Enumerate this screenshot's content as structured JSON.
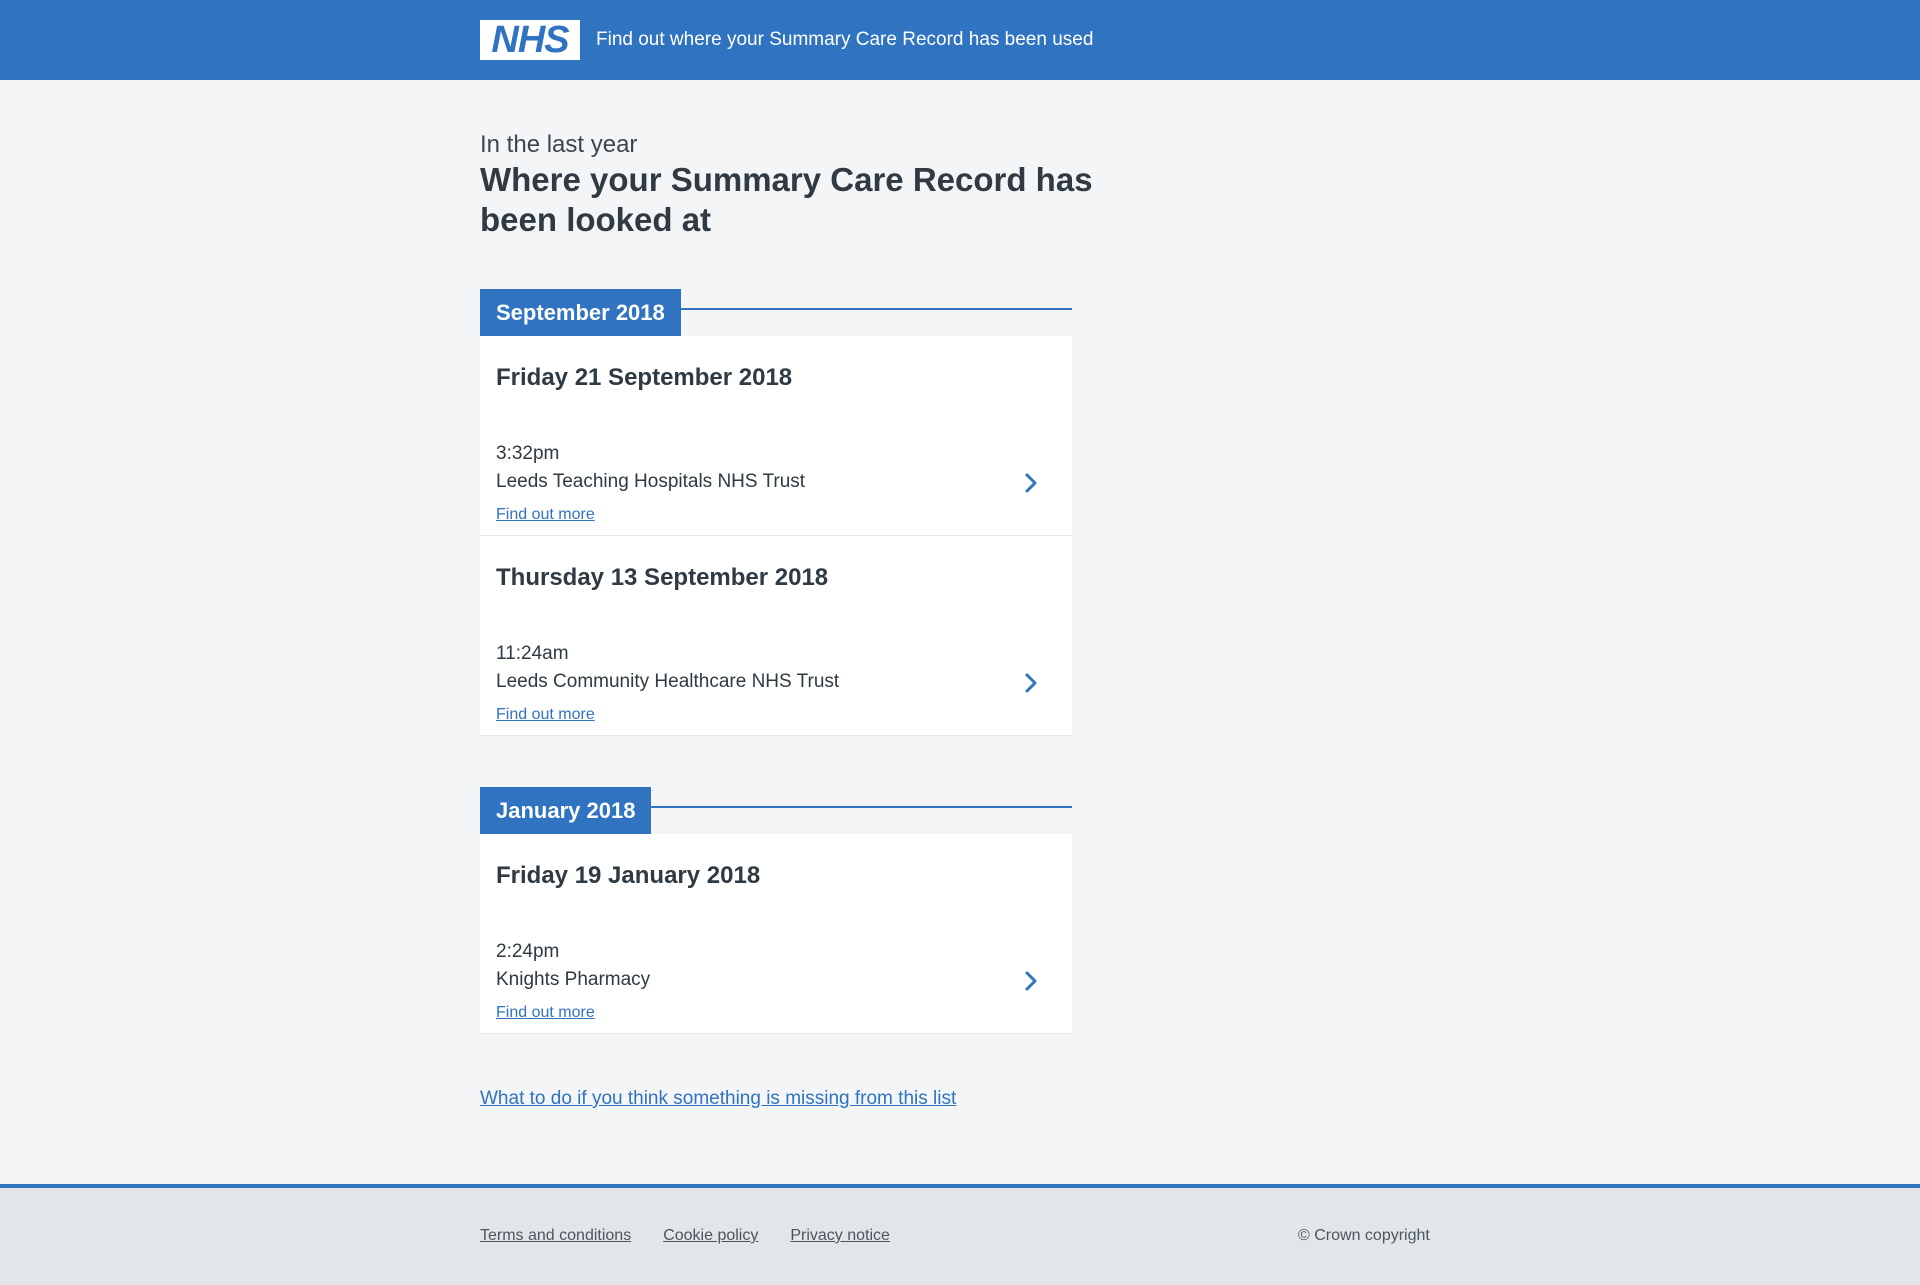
{
  "header": {
    "logo_text": "NHS",
    "title": "Find out where your Summary Care Record has been used"
  },
  "main": {
    "caption": "In the last year",
    "title": "Where your Summary Care Record has been looked at",
    "months": [
      {
        "label": "September 2018",
        "entries": [
          {
            "date": "Friday 21 September 2018",
            "time": "3:32pm",
            "place": "Leeds Teaching Hospitals NHS Trust",
            "link": "Find out more"
          },
          {
            "date": "Thursday 13 September 2018",
            "time": "11:24am",
            "place": "Leeds Community Healthcare NHS Trust",
            "link": "Find out more"
          }
        ]
      },
      {
        "label": "January 2018",
        "entries": [
          {
            "date": "Friday 19 January 2018",
            "time": "2:24pm",
            "place": "Knights Pharmacy",
            "link": "Find out more"
          }
        ]
      }
    ],
    "missing_link": "What to do if you think something is missing from this list"
  },
  "footer": {
    "links": [
      "Terms and conditions",
      "Cookie policy",
      "Privacy notice"
    ],
    "copyright": "© Crown copyright"
  },
  "colors": {
    "brand_blue": "#2f73c1",
    "background": "#f4f5f6",
    "text": "#2f3a42",
    "footer_bg": "#e3e6e8"
  },
  "icons": {
    "entry_arrow": "chevron-right-icon"
  }
}
